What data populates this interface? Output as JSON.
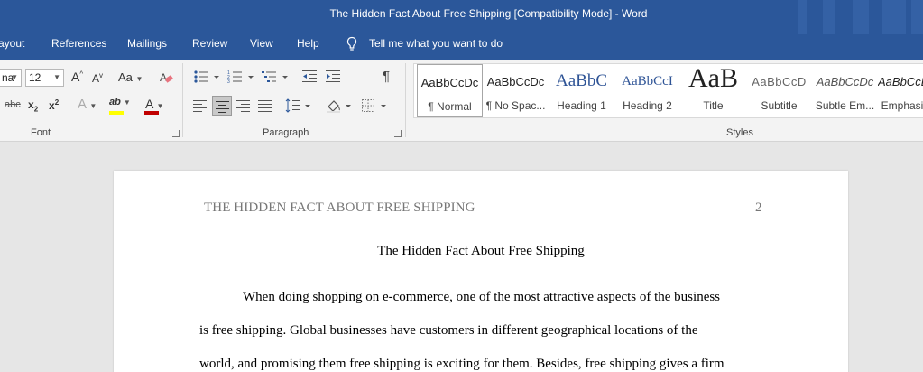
{
  "window": {
    "title": "The Hidden Fact About Free Shipping [Compatibility Mode]  -  Word"
  },
  "tabs": [
    {
      "label": "ayout"
    },
    {
      "label": "References"
    },
    {
      "label": "Mailings"
    },
    {
      "label": "Review"
    },
    {
      "label": "View"
    },
    {
      "label": "Help"
    }
  ],
  "tell_me": {
    "label": "Tell me what you want to do"
  },
  "font_group": {
    "label": "Font",
    "font_name": "na",
    "font_size": "12",
    "grow_label": "A",
    "shrink_label": "A",
    "case_label": "Aa",
    "strike_label": "abc",
    "subscript_label": "x",
    "superscript_label": "x",
    "effects_label": "A",
    "highlight_label": "ab",
    "font_color_label": "A",
    "font_color": "#c00000",
    "highlight_color": "#ffff00"
  },
  "paragraph_group": {
    "label": "Paragraph",
    "pilcrow": "¶"
  },
  "styles_group": {
    "label": "Styles",
    "items": [
      {
        "preview": "AaBbCcDc",
        "name": "¶ Normal"
      },
      {
        "preview": "AaBbCcDc",
        "name": "¶ No Spac..."
      },
      {
        "preview": "AaBbC",
        "name": "Heading 1"
      },
      {
        "preview": "AaBbCcI",
        "name": "Heading 2"
      },
      {
        "preview": "AaB",
        "name": "Title"
      },
      {
        "preview": "AaBbCcD",
        "name": "Subtitle"
      },
      {
        "preview": "AaBbCcDc",
        "name": "Subtle Em..."
      },
      {
        "preview": "AaBbCcDc",
        "name": "Emphasis"
      }
    ]
  },
  "document": {
    "header": "THE HIDDEN FACT ABOUT FREE SHIPPING",
    "page_number": "2",
    "title": "The Hidden Fact About Free Shipping",
    "lines": [
      "When doing shopping on e-commerce, one of the most attractive aspects of the business",
      "is free shipping. Global businesses have customers in different geographical locations of the",
      "world, and promising them free shipping is exciting for them. Besides, free shipping gives a firm"
    ]
  },
  "colors": {
    "word_blue": "#2b579a",
    "ribbon_bg": "#f3f3f3",
    "canvas_bg": "#e6e6e6"
  }
}
